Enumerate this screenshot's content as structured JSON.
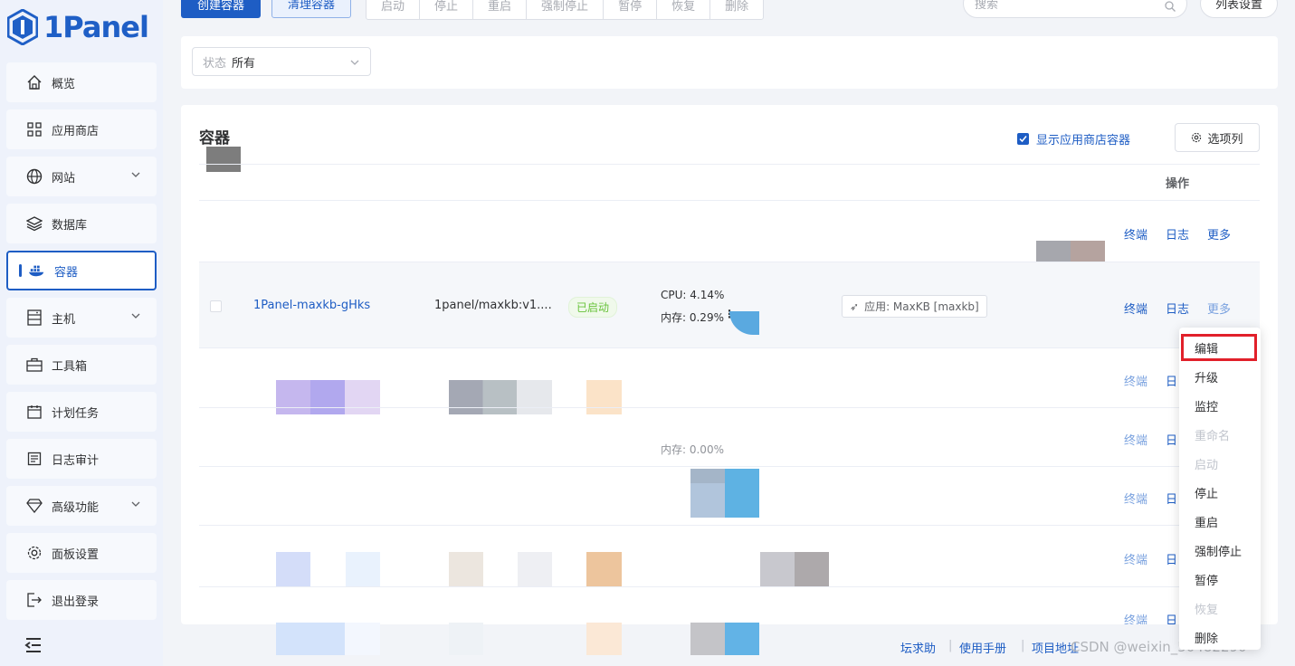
{
  "brand": {
    "logo_text": "1Panel"
  },
  "sidebar": {
    "items": [
      {
        "label": "概览",
        "icon": "home-icon"
      },
      {
        "label": "应用商店",
        "icon": "grid-icon"
      },
      {
        "label": "网站",
        "icon": "globe-icon"
      },
      {
        "label": "数据库",
        "icon": "layers-icon"
      },
      {
        "label": "容器",
        "icon": "docker-icon"
      },
      {
        "label": "主机",
        "icon": "server-icon"
      },
      {
        "label": "工具箱",
        "icon": "toolbox-icon"
      },
      {
        "label": "计划任务",
        "icon": "calendar-icon"
      },
      {
        "label": "日志审计",
        "icon": "log-icon"
      },
      {
        "label": "高级功能",
        "icon": "diamond-icon"
      },
      {
        "label": "面板设置",
        "icon": "gear-icon"
      },
      {
        "label": "退出登录",
        "icon": "logout-icon"
      }
    ]
  },
  "toolbar": {
    "create_label": "创建容器",
    "clean_label": "清理容器",
    "group": [
      "启动",
      "停止",
      "重启",
      "强制停止",
      "暂停",
      "恢复",
      "删除"
    ],
    "search_placeholder": "搜索",
    "list_settings_label": "列表设置"
  },
  "filter": {
    "status_key": "状态",
    "status_value": "所有"
  },
  "section": {
    "title": "容器",
    "show_app_label": "显示应用商店容器",
    "columns_button": "选项列",
    "op_header": "操作"
  },
  "row": {
    "name": "1Panel-maxkb-gHks",
    "image": "1panel/maxkb:v1....",
    "status": "已启动",
    "cpu": "CPU: 4.14%",
    "mem": "内存: 0.29%",
    "app_tag": "应用: MaxKB [maxkb]"
  },
  "actions": {
    "terminal": "终端",
    "log": "日志",
    "more": "更多",
    "log_short": "日"
  },
  "dropdown": [
    {
      "label": "编辑",
      "disabled": false
    },
    {
      "label": "升级",
      "disabled": false
    },
    {
      "label": "监控",
      "disabled": false
    },
    {
      "label": "重命名",
      "disabled": true
    },
    {
      "label": "启动",
      "disabled": true
    },
    {
      "label": "停止",
      "disabled": false
    },
    {
      "label": "重启",
      "disabled": false
    },
    {
      "label": "强制停止",
      "disabled": false
    },
    {
      "label": "暂停",
      "disabled": false
    },
    {
      "label": "恢复",
      "disabled": true
    },
    {
      "label": "删除",
      "disabled": false
    }
  ],
  "partial_mem": "内存: 0.00%",
  "footer": {
    "forum": "坛求助",
    "manual": "使用手册",
    "project": "项目地址"
  },
  "watermark": "CSDN @weixin_50482290",
  "colors": {
    "primary": "#1e5dc4",
    "highlight_box": "#e1202a",
    "running": "#67c23a"
  }
}
